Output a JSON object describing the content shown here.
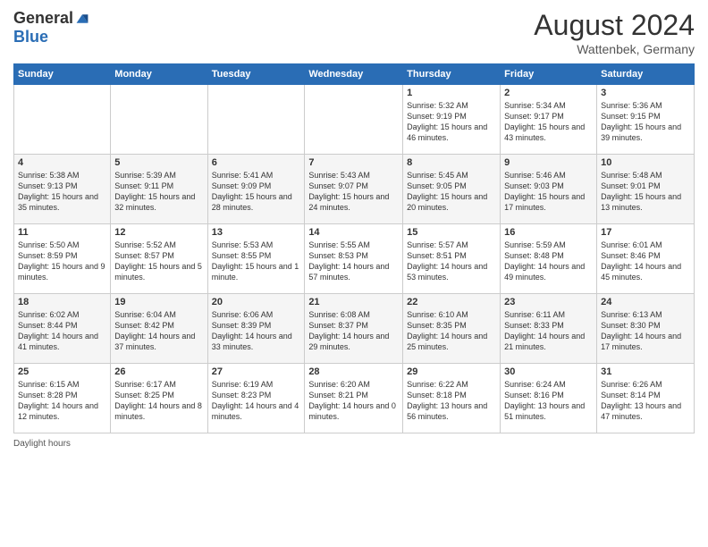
{
  "logo": {
    "general": "General",
    "blue": "Blue"
  },
  "header": {
    "month_year": "August 2024",
    "location": "Wattenbek, Germany"
  },
  "weekdays": [
    "Sunday",
    "Monday",
    "Tuesday",
    "Wednesday",
    "Thursday",
    "Friday",
    "Saturday"
  ],
  "footer": {
    "daylight_label": "Daylight hours"
  },
  "weeks": [
    [
      {
        "day": "",
        "sunrise": "",
        "sunset": "",
        "daylight": ""
      },
      {
        "day": "",
        "sunrise": "",
        "sunset": "",
        "daylight": ""
      },
      {
        "day": "",
        "sunrise": "",
        "sunset": "",
        "daylight": ""
      },
      {
        "day": "",
        "sunrise": "",
        "sunset": "",
        "daylight": ""
      },
      {
        "day": "1",
        "sunrise": "Sunrise: 5:32 AM",
        "sunset": "Sunset: 9:19 PM",
        "daylight": "Daylight: 15 hours and 46 minutes."
      },
      {
        "day": "2",
        "sunrise": "Sunrise: 5:34 AM",
        "sunset": "Sunset: 9:17 PM",
        "daylight": "Daylight: 15 hours and 43 minutes."
      },
      {
        "day": "3",
        "sunrise": "Sunrise: 5:36 AM",
        "sunset": "Sunset: 9:15 PM",
        "daylight": "Daylight: 15 hours and 39 minutes."
      }
    ],
    [
      {
        "day": "4",
        "sunrise": "Sunrise: 5:38 AM",
        "sunset": "Sunset: 9:13 PM",
        "daylight": "Daylight: 15 hours and 35 minutes."
      },
      {
        "day": "5",
        "sunrise": "Sunrise: 5:39 AM",
        "sunset": "Sunset: 9:11 PM",
        "daylight": "Daylight: 15 hours and 32 minutes."
      },
      {
        "day": "6",
        "sunrise": "Sunrise: 5:41 AM",
        "sunset": "Sunset: 9:09 PM",
        "daylight": "Daylight: 15 hours and 28 minutes."
      },
      {
        "day": "7",
        "sunrise": "Sunrise: 5:43 AM",
        "sunset": "Sunset: 9:07 PM",
        "daylight": "Daylight: 15 hours and 24 minutes."
      },
      {
        "day": "8",
        "sunrise": "Sunrise: 5:45 AM",
        "sunset": "Sunset: 9:05 PM",
        "daylight": "Daylight: 15 hours and 20 minutes."
      },
      {
        "day": "9",
        "sunrise": "Sunrise: 5:46 AM",
        "sunset": "Sunset: 9:03 PM",
        "daylight": "Daylight: 15 hours and 17 minutes."
      },
      {
        "day": "10",
        "sunrise": "Sunrise: 5:48 AM",
        "sunset": "Sunset: 9:01 PM",
        "daylight": "Daylight: 15 hours and 13 minutes."
      }
    ],
    [
      {
        "day": "11",
        "sunrise": "Sunrise: 5:50 AM",
        "sunset": "Sunset: 8:59 PM",
        "daylight": "Daylight: 15 hours and 9 minutes."
      },
      {
        "day": "12",
        "sunrise": "Sunrise: 5:52 AM",
        "sunset": "Sunset: 8:57 PM",
        "daylight": "Daylight: 15 hours and 5 minutes."
      },
      {
        "day": "13",
        "sunrise": "Sunrise: 5:53 AM",
        "sunset": "Sunset: 8:55 PM",
        "daylight": "Daylight: 15 hours and 1 minute."
      },
      {
        "day": "14",
        "sunrise": "Sunrise: 5:55 AM",
        "sunset": "Sunset: 8:53 PM",
        "daylight": "Daylight: 14 hours and 57 minutes."
      },
      {
        "day": "15",
        "sunrise": "Sunrise: 5:57 AM",
        "sunset": "Sunset: 8:51 PM",
        "daylight": "Daylight: 14 hours and 53 minutes."
      },
      {
        "day": "16",
        "sunrise": "Sunrise: 5:59 AM",
        "sunset": "Sunset: 8:48 PM",
        "daylight": "Daylight: 14 hours and 49 minutes."
      },
      {
        "day": "17",
        "sunrise": "Sunrise: 6:01 AM",
        "sunset": "Sunset: 8:46 PM",
        "daylight": "Daylight: 14 hours and 45 minutes."
      }
    ],
    [
      {
        "day": "18",
        "sunrise": "Sunrise: 6:02 AM",
        "sunset": "Sunset: 8:44 PM",
        "daylight": "Daylight: 14 hours and 41 minutes."
      },
      {
        "day": "19",
        "sunrise": "Sunrise: 6:04 AM",
        "sunset": "Sunset: 8:42 PM",
        "daylight": "Daylight: 14 hours and 37 minutes."
      },
      {
        "day": "20",
        "sunrise": "Sunrise: 6:06 AM",
        "sunset": "Sunset: 8:39 PM",
        "daylight": "Daylight: 14 hours and 33 minutes."
      },
      {
        "day": "21",
        "sunrise": "Sunrise: 6:08 AM",
        "sunset": "Sunset: 8:37 PM",
        "daylight": "Daylight: 14 hours and 29 minutes."
      },
      {
        "day": "22",
        "sunrise": "Sunrise: 6:10 AM",
        "sunset": "Sunset: 8:35 PM",
        "daylight": "Daylight: 14 hours and 25 minutes."
      },
      {
        "day": "23",
        "sunrise": "Sunrise: 6:11 AM",
        "sunset": "Sunset: 8:33 PM",
        "daylight": "Daylight: 14 hours and 21 minutes."
      },
      {
        "day": "24",
        "sunrise": "Sunrise: 6:13 AM",
        "sunset": "Sunset: 8:30 PM",
        "daylight": "Daylight: 14 hours and 17 minutes."
      }
    ],
    [
      {
        "day": "25",
        "sunrise": "Sunrise: 6:15 AM",
        "sunset": "Sunset: 8:28 PM",
        "daylight": "Daylight: 14 hours and 12 minutes."
      },
      {
        "day": "26",
        "sunrise": "Sunrise: 6:17 AM",
        "sunset": "Sunset: 8:25 PM",
        "daylight": "Daylight: 14 hours and 8 minutes."
      },
      {
        "day": "27",
        "sunrise": "Sunrise: 6:19 AM",
        "sunset": "Sunset: 8:23 PM",
        "daylight": "Daylight: 14 hours and 4 minutes."
      },
      {
        "day": "28",
        "sunrise": "Sunrise: 6:20 AM",
        "sunset": "Sunset: 8:21 PM",
        "daylight": "Daylight: 14 hours and 0 minutes."
      },
      {
        "day": "29",
        "sunrise": "Sunrise: 6:22 AM",
        "sunset": "Sunset: 8:18 PM",
        "daylight": "Daylight: 13 hours and 56 minutes."
      },
      {
        "day": "30",
        "sunrise": "Sunrise: 6:24 AM",
        "sunset": "Sunset: 8:16 PM",
        "daylight": "Daylight: 13 hours and 51 minutes."
      },
      {
        "day": "31",
        "sunrise": "Sunrise: 6:26 AM",
        "sunset": "Sunset: 8:14 PM",
        "daylight": "Daylight: 13 hours and 47 minutes."
      }
    ]
  ]
}
